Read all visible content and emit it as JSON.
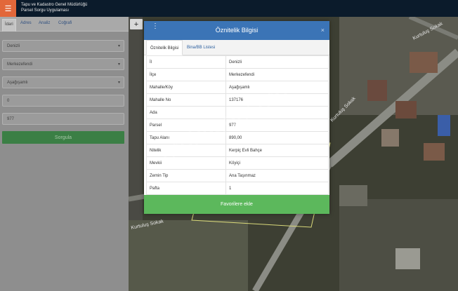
{
  "header": {
    "menu_icon": "hamburger-icon",
    "title_line1": "Tapu ve Kadastro Genel Müdürlüğü",
    "title_line2": "Parsel Sorgu Uygulaması",
    "accent_color": "#e2673a"
  },
  "sidebar": {
    "tabs": [
      {
        "label": "İdari"
      },
      {
        "label": "Adres"
      },
      {
        "label": "Analiz"
      },
      {
        "label": "Coğrafi"
      }
    ],
    "fields": [
      {
        "value": "Denizli"
      },
      {
        "value": "Merkezefendi"
      },
      {
        "value": "Aşağışamlı"
      },
      {
        "value": "0"
      },
      {
        "value": "977"
      }
    ],
    "search_button": "Sorgula"
  },
  "map": {
    "zoom_in": "+",
    "street_labels": [
      "Kurtuluş Sokak",
      "Kurtuluş Sokak",
      "Kurtuluş Sokak"
    ],
    "watermark": "emlakjet.com"
  },
  "modal": {
    "title": "Öznitelik Bilgisi",
    "close": "×",
    "tabs": [
      {
        "label": "Öznitelik Bilgisi"
      },
      {
        "label": "Bina/BB Listesi"
      }
    ],
    "rows": [
      {
        "key": "İl",
        "value": "Denizli"
      },
      {
        "key": "İlçe",
        "value": "Merkezefendi"
      },
      {
        "key": "Mahalle/Köy",
        "value": "Aşağışamlı"
      },
      {
        "key": "Mahalle No",
        "value": "137176"
      },
      {
        "key": "Ada",
        "value": ""
      },
      {
        "key": "Parsel",
        "value": "977"
      },
      {
        "key": "Tapu Alanı",
        "value": "890,00"
      },
      {
        "key": "Nitelik",
        "value": "Kerpiç Evli Bahçe"
      },
      {
        "key": "Mevkii",
        "value": "Köyiçi"
      },
      {
        "key": "Zemin Tip",
        "value": "Ana Taşınmaz"
      },
      {
        "key": "Pafta",
        "value": "1"
      }
    ],
    "favorite_button": "Favorilere ekle",
    "header_color": "#3b74b6",
    "button_color": "#5cb85c"
  }
}
